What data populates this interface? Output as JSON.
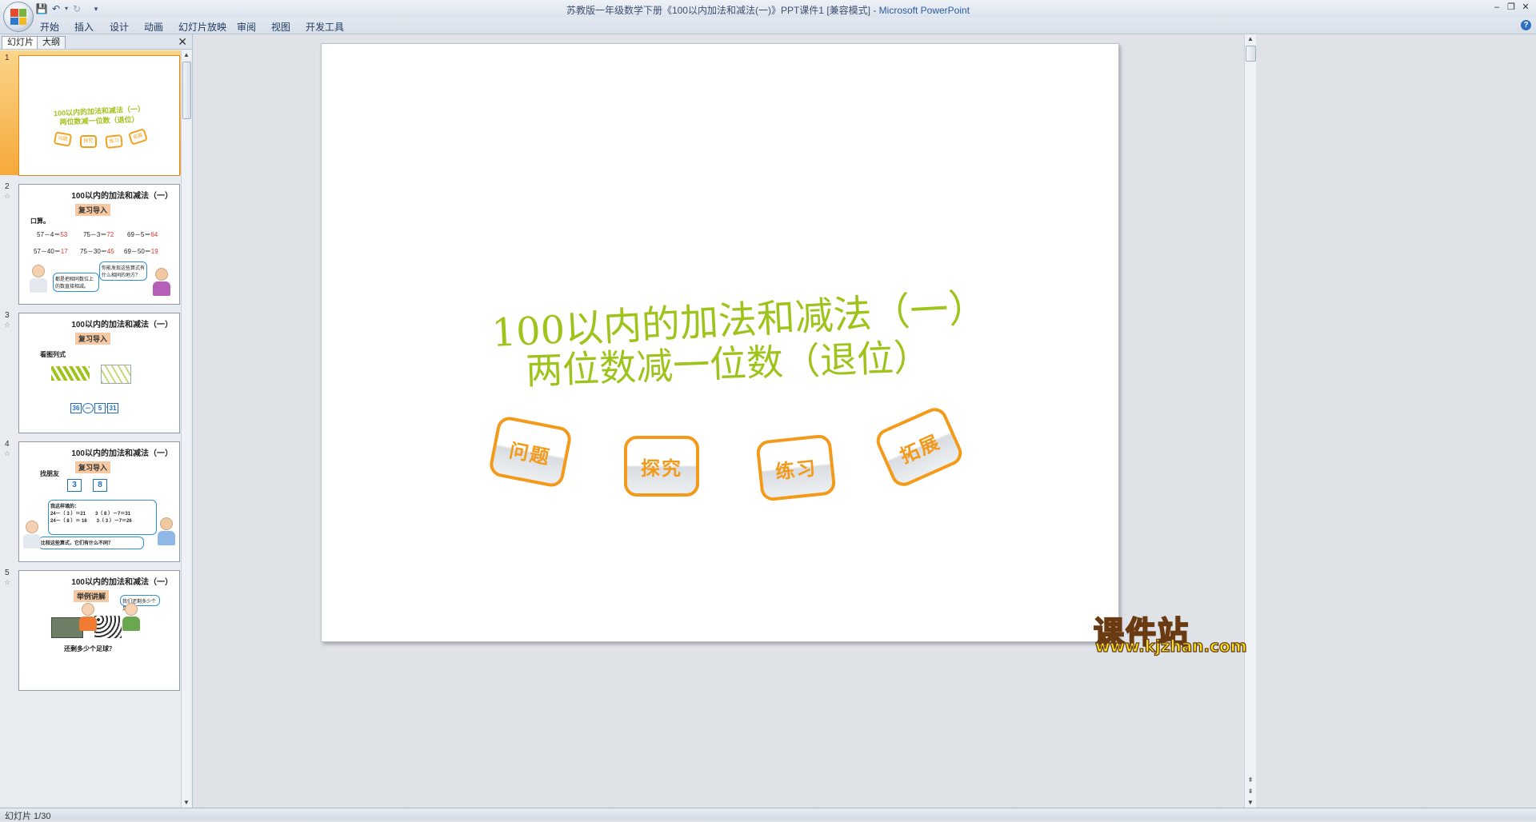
{
  "window": {
    "title": "苏教版一年级数学下册《100以内加法和减法(一)》PPT课件1 [兼容模式] - ",
    "app_name": "Microsoft PowerPoint"
  },
  "ribbon": {
    "tabs": [
      "开始",
      "插入",
      "设计",
      "动画",
      "幻灯片放映",
      "审阅",
      "视图",
      "开发工具"
    ]
  },
  "left_pane": {
    "tabs": [
      "幻灯片",
      "大纲"
    ],
    "slides": [
      {
        "num": "1",
        "title_line1": "100以内的加法和减法（一）",
        "title_line2": "两位数减一位数（退位）",
        "buttons": [
          "问题",
          "探究",
          "练习",
          "拓展"
        ]
      },
      {
        "num": "2",
        "header": "100以内的加法和减法（一）",
        "badge": "复习导入",
        "label": "口算。",
        "row1": [
          {
            "q": "57－4＝",
            "a": "53"
          },
          {
            "q": "75－3＝",
            "a": "72"
          },
          {
            "q": "69－5＝",
            "a": "64"
          }
        ],
        "row2": [
          {
            "q": "57－40＝",
            "a": "17"
          },
          {
            "q": "75－30＝",
            "a": "45"
          },
          {
            "q": "69－50＝",
            "a": "19"
          }
        ],
        "bubble1": "你能发现这些算式有什么相同的地方？",
        "bubble2": "都是把相同数位上的数直接相减。"
      },
      {
        "num": "3",
        "header": "100以内的加法和减法（一）",
        "badge": "复习导入",
        "label": "看图列式",
        "eq": [
          "36",
          "－",
          "5",
          "＝",
          "31"
        ]
      },
      {
        "num": "4",
        "header": "100以内的加法和减法（一）",
        "badge": "复习导入",
        "label": "找朋友",
        "cards": [
          "3",
          "8"
        ],
        "bubble_title": "我这样填的：",
        "lines": [
          "24－（ 3 ）＝21　　3（ 8 ）－7＝31",
          "24－（ 8 ）＝ 16　　3（ 3 ）－7＝26"
        ],
        "question": "比较这些算式，它们有什么不同？"
      },
      {
        "num": "5",
        "header": "100以内的加法和减法（一）",
        "badge": "举例讲解",
        "bubble": "我们还剩多少个足球？",
        "label": "还剩多少个足球？"
      }
    ]
  },
  "slide": {
    "title_line1": "100以内的加法和减法（一）",
    "title_line2": "两位数减一位数（退位）",
    "buttons": [
      {
        "label": "问题"
      },
      {
        "label": "探究"
      },
      {
        "label": "练习"
      },
      {
        "label": "拓展"
      }
    ]
  },
  "status": {
    "text": "幻灯片 1/30"
  },
  "watermark": {
    "big": "课件站",
    "url": "www.kjzhan.com"
  },
  "colors": {
    "title_green": "#9ec41c",
    "button_orange": "#f49a1a",
    "selected_thumb": "#f6a93a",
    "watermark_yellow": "#f7e51a"
  }
}
